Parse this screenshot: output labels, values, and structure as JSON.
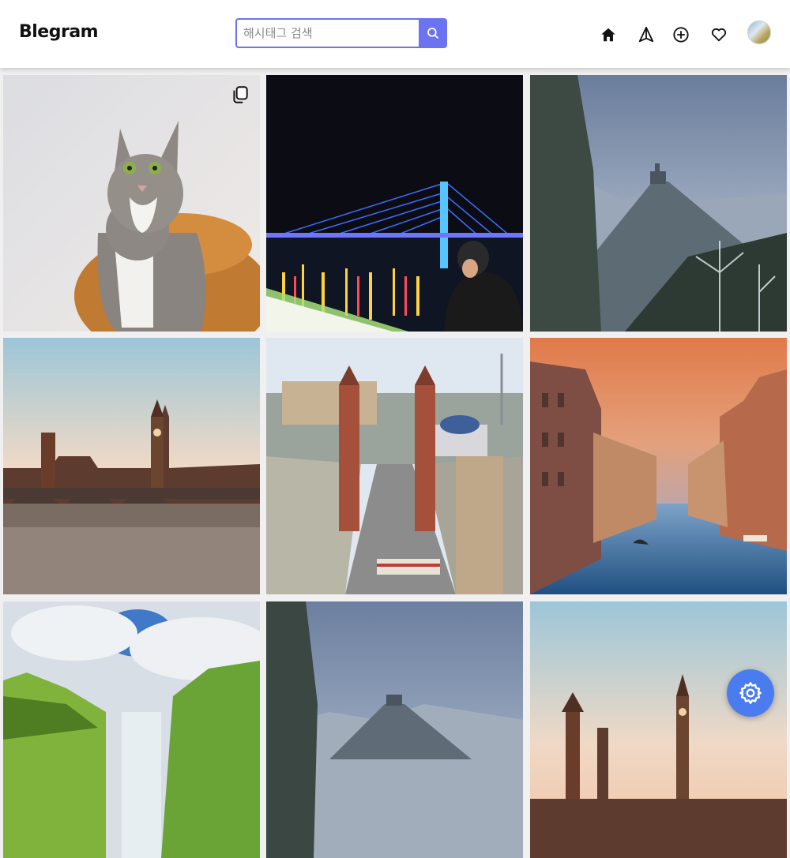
{
  "header": {
    "logo": "Blegram",
    "search": {
      "placeholder": "해시태그 검색",
      "value": ""
    },
    "icons": [
      "home-icon",
      "explore-icon",
      "add-post-icon",
      "heart-icon",
      "avatar"
    ]
  },
  "feed": {
    "posts": [
      {
        "subject": "cat",
        "multi_image": true
      },
      {
        "subject": "night-bridge",
        "multi_image": false
      },
      {
        "subject": "winter-castle",
        "multi_image": false
      },
      {
        "subject": "london-sunset",
        "multi_image": false
      },
      {
        "subject": "barcelona-towers",
        "multi_image": false
      },
      {
        "subject": "venice-canal",
        "multi_image": false
      },
      {
        "subject": "waterfall-cliffs",
        "multi_image": false
      },
      {
        "subject": "winter-castle-2",
        "multi_image": false
      },
      {
        "subject": "london-sunset-2",
        "multi_image": false
      }
    ]
  },
  "colors": {
    "accent": "#6b73f0",
    "fab": "#4a7cf0"
  }
}
